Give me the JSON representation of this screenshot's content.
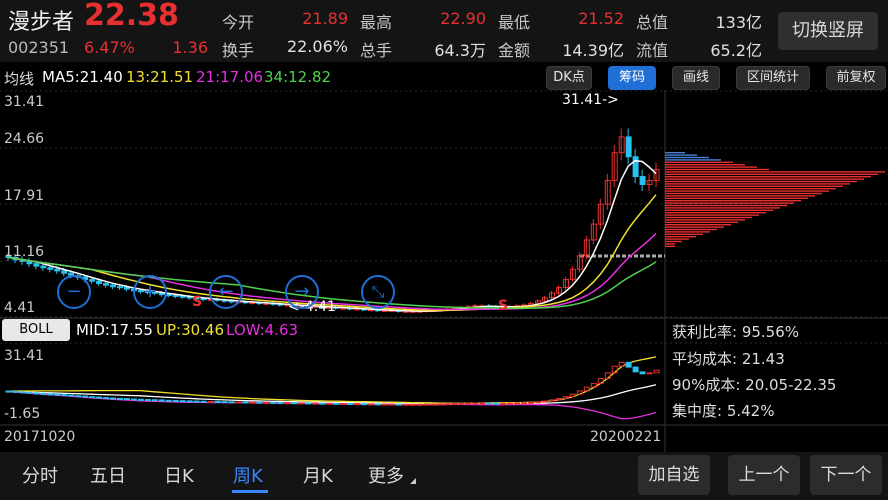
{
  "stock": {
    "name": "漫步者",
    "price": "22.38",
    "code": "002351",
    "change_pct": "6.47%",
    "change_amt": "1.36"
  },
  "quote": {
    "open_label": "今开",
    "open": "21.89",
    "high_label": "最高",
    "high": "22.90",
    "low_label": "最低",
    "low": "21.52",
    "mcap_label": "总值",
    "mcap": "133亿",
    "turnover_label": "换手",
    "turnover": "22.06%",
    "vol_label": "总手",
    "vol": "64.3万",
    "amount_label": "金额",
    "amount": "14.39亿",
    "float_label": "流值",
    "float": "65.2亿"
  },
  "switch_button": "切换竖屏",
  "ma": {
    "label": "均线",
    "ma5": "MA5:21.40",
    "ma13": "13:21.51",
    "ma21": "21:17.06",
    "ma34": "34:12.82"
  },
  "toolbar": {
    "dk": "DK点",
    "chips": "筹码",
    "draw": "画线",
    "interval": "区间统计",
    "adjust": "前复权"
  },
  "price_axis": [
    "31.41",
    "24.66",
    "17.91",
    "11.16",
    "4.41"
  ],
  "annotations": {
    "high_mark": "31.41->",
    "low_mark": "<-4.41",
    "s1": "S",
    "s2": "S"
  },
  "boll": {
    "label": "BOLL",
    "mid": "MID:17.55",
    "up": "UP:30.46",
    "low": "LOW:4.63"
  },
  "boll_axis": [
    "31.41",
    "-1.65"
  ],
  "chip_info": {
    "profit": "获利比率: 95.56%",
    "avg": "平均成本: 21.43",
    "range90": "90%成本: 20.05-22.35",
    "concentration": "集中度: 5.42%"
  },
  "dates": {
    "start": "20171020",
    "end": "20200221"
  },
  "tabs": [
    "分时",
    "五日",
    "日K",
    "周K",
    "月K",
    "更多"
  ],
  "active_tab": "周K",
  "actions": {
    "add": "加自选",
    "prev": "上一个",
    "next": "下一个"
  },
  "colors": {
    "up": "#e83030",
    "down": "#27c2ee",
    "ma5": "#ffffff",
    "ma13": "#f2e12a",
    "ma21": "#e52fe0",
    "ma34": "#4fd34f",
    "accent": "#1f6fd6"
  },
  "chart_data": {
    "type": "candlestick",
    "period": "weekly",
    "x_range": [
      "20171020",
      "20200221"
    ],
    "ylim": [
      4.41,
      31.41
    ],
    "close_series": [
      11.3,
      11.0,
      10.8,
      10.5,
      10.2,
      10.0,
      9.8,
      9.6,
      9.3,
      9.0,
      8.8,
      8.5,
      8.3,
      8.0,
      7.8,
      7.6,
      7.5,
      7.3,
      7.1,
      7.0,
      6.9,
      6.8,
      6.6,
      6.5,
      6.4,
      6.3,
      6.2,
      6.1,
      6.0,
      6.0,
      5.9,
      5.8,
      5.7,
      5.7,
      5.6,
      5.6,
      5.5,
      5.5,
      5.4,
      5.3,
      5.3,
      5.2,
      5.2,
      5.1,
      5.1,
      5.0,
      5.0,
      4.9,
      4.9,
      4.8,
      4.8,
      4.7,
      4.7,
      4.6,
      4.6,
      4.6,
      4.5,
      4.5,
      4.5,
      4.5,
      4.6,
      4.6,
      4.7,
      4.8,
      4.9,
      5.0,
      5.1,
      5.2,
      5.2,
      5.1,
      5.0,
      5.0,
      5.1,
      5.2,
      5.3,
      5.5,
      5.8,
      6.2,
      6.8,
      7.5,
      8.5,
      9.8,
      11.5,
      13.5,
      15.5,
      18.0,
      21.0,
      24.5,
      26.5,
      24.0,
      21.5,
      20.5,
      21.0,
      22.38
    ],
    "ma5_last": 21.4,
    "ma13_last": 21.51,
    "ma21_last": 17.06,
    "ma34_last": 12.82,
    "boll": {
      "mid": 17.55,
      "up": 30.46,
      "low": 4.63
    },
    "boll_ylim": [
      -1.65,
      31.41
    ]
  }
}
